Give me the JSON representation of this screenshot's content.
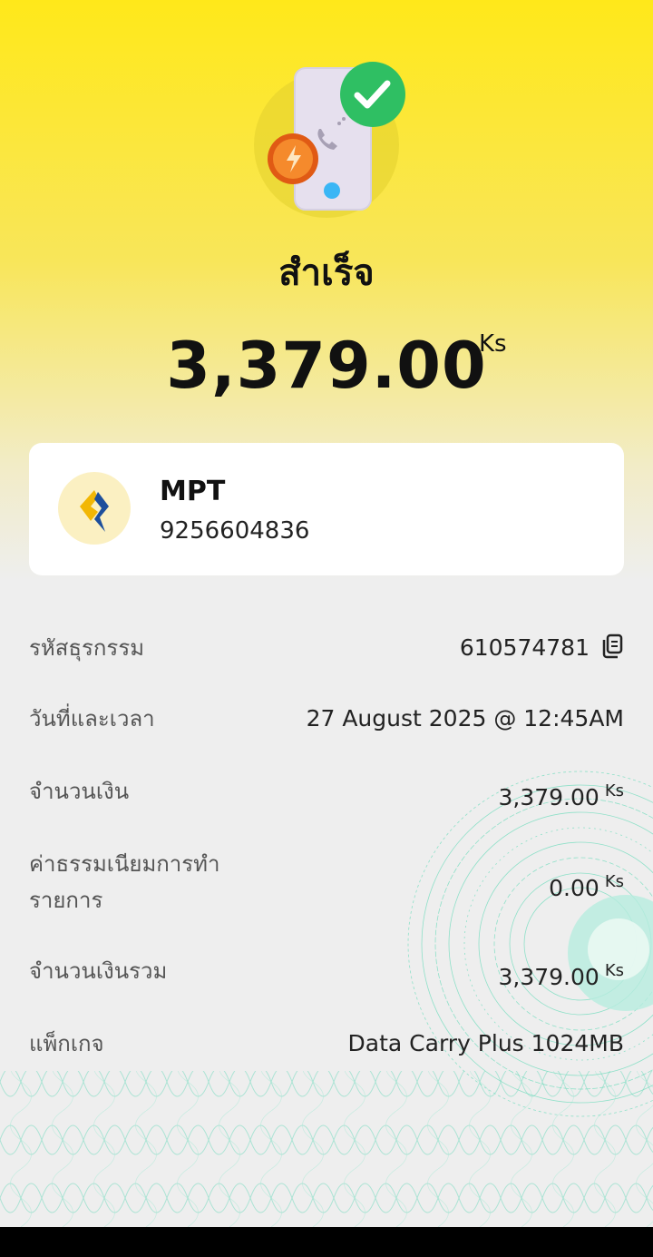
{
  "status": {
    "title": "สำเร็จ"
  },
  "amount": {
    "value": "3,379.00",
    "currency": "Ks"
  },
  "merchant": {
    "name": "MPT",
    "number": "9256604836"
  },
  "details": [
    {
      "label": "รหัสธุรกรรม",
      "value": "610574781",
      "copy_icon": "copy-icon"
    },
    {
      "label": "วันที่และเวลา",
      "value": "27 August 2025 @ 12:45AM"
    },
    {
      "label": "จำนวนเงิน",
      "value": "3,379.00",
      "currency": "Ks"
    },
    {
      "label_line1": "ค่าธรรมเนียมการทำ",
      "label_line2": "รายการ",
      "value": "0.00",
      "currency": "Ks"
    },
    {
      "label": "จำนวนเงินรวม",
      "value": "3,379.00",
      "currency": "Ks"
    },
    {
      "label": "แพ็กเกจ",
      "value": "Data Carry Plus 1024MB"
    }
  ],
  "colors": {
    "brand_yellow": "#ffe81a",
    "success_green": "#2fbf63",
    "flash_orange": "#ef6d1f",
    "pattern_teal": "#5fd6b3"
  },
  "icons": {
    "success": "checkmark-icon",
    "flash": "lightning-icon",
    "phone": "phone-icon",
    "merchant_logo": "mpt-logo-icon"
  }
}
